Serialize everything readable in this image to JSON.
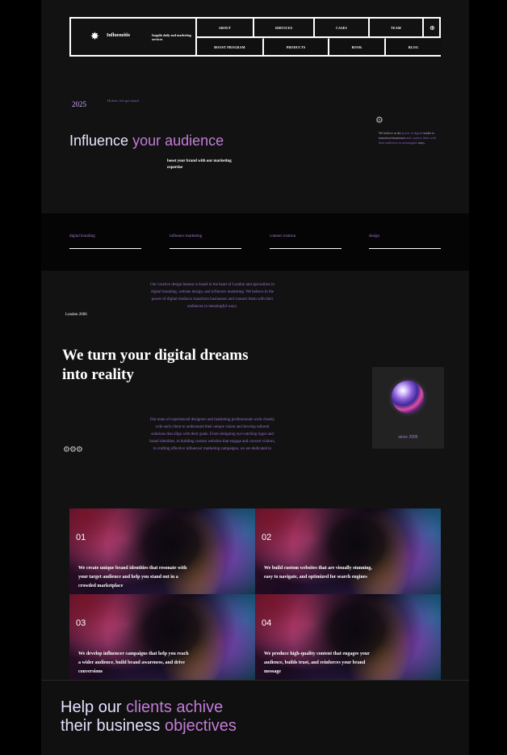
{
  "brand": {
    "name": "Influenzitis",
    "tagline": "Izogolis daily and marketing services"
  },
  "nav": {
    "top": [
      "ABOUT",
      "SERVICES",
      "CASES",
      "TEAM"
    ],
    "bottom": [
      "BOOST PROGRAM",
      "PRODUCTS",
      "BOOK",
      "BLOG"
    ],
    "icon": "globe-icon"
  },
  "hero": {
    "year": "2025",
    "hi_text": "Hi there, let's get started",
    "title_plain": "Influence",
    "title_accent": "your audience",
    "subtitle": "boost your brand with our marketing expertise",
    "side_text_a": "We believe in the",
    "side_text_b": "power of digital",
    "side_text_c": "media to transform businesses",
    "side_text_d": "and connect them with their audiences in meaningful",
    "side_text_e": "ways."
  },
  "services": [
    "digital branding",
    "influence marketing",
    "content creation",
    "design"
  ],
  "about": {
    "text": "Our creative design bureau is based in the heart of London and specializes in digital branding, website design, and influence marketing. We believe in the power of digital media to transform businesses and connect them with their audiences in meaningful ways.",
    "location": "London 2006",
    "title": "We turn your digital dreams into reality",
    "team_text": "Our team of experienced designers and marketing professionals work closely with each client to understand their unique vision and develop tailored solutions that align with their goals. From designing eye-catching logos and brand identities, to building custom websites that engage and convert visitors, to crafting effective influencer marketing campaigns, we are dedicated to",
    "since": "since 2006"
  },
  "cards": [
    {
      "num": "01",
      "text": "We create unique brand identities that resonate with your target audience and help you stand out in a crowded marketplace"
    },
    {
      "num": "02",
      "text": "We build custom websites that are visually stunning, easy to navigate, and optimized for search engines"
    },
    {
      "num": "03",
      "text": "We develop influencer campaigns that help you reach a wider audience, build brand awareness, and drive conversions"
    },
    {
      "num": "04",
      "text": "We produce high-quality content that engages your audience, builds trust, and reinforces your brand message"
    }
  ],
  "bottom": {
    "line1_plain": "Help our",
    "line1_accent": "clients achive",
    "line2_plain": "their business",
    "line2_accent": "objectives"
  },
  "colors": {
    "accent": "#c37cd8",
    "purple_text": "#9b72cf",
    "background": "#121212"
  }
}
